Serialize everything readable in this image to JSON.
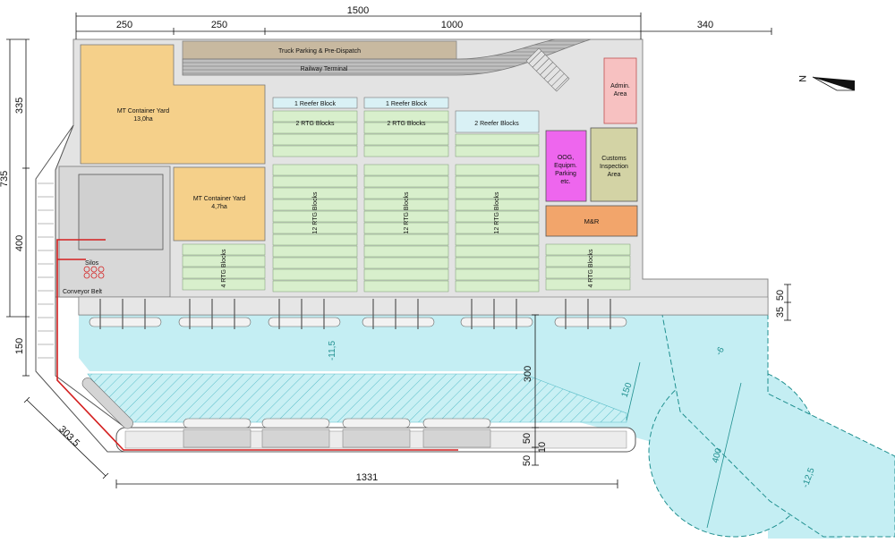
{
  "dimensions": {
    "top_total": "1500",
    "top_left_1": "250",
    "top_left_2": "250",
    "top_mid": "1000",
    "top_right": "340",
    "left_335": "335",
    "left_735": "735",
    "left_400": "400",
    "left_150": "150",
    "right_50": "50",
    "right_35": "35",
    "berth_300": "300",
    "d150": "150",
    "d400": "400",
    "d50a": "50",
    "d10": "10",
    "d50b": "50",
    "bottom_1331": "1331",
    "diag_303": "303.5"
  },
  "labels": {
    "truck_parking": "Truck Parking & Pre-Dispatch",
    "railway": "Railway Terminal",
    "mt_yard_1": "MT Container Yard",
    "mt_yard_1_area": "13,0ha",
    "mt_yard_2": "MT Container Yard",
    "mt_yard_2_area": "4,7ha",
    "reefer_1": "1 Reefer Block",
    "reefer_2": "1 Reefer Block",
    "reefer_3": "2 Reefer Blocks",
    "rtg2_a": "2 RTG Blocks",
    "rtg2_b": "2 RTG Blocks",
    "rtg12_a": "12 RTG Blocks",
    "rtg12_b": "12 RTG Blocks",
    "rtg12_c": "12 RTG Blocks",
    "rtg4_a": "4 RTG Blocks",
    "rtg4_b": "4 RTG Blocks",
    "admin_1": "Admin.",
    "admin_2": "Area",
    "oog_1": "OOG,",
    "oog_2": "Equipm.",
    "oog_3": "Parking",
    "oog_4": "etc.",
    "customs_1": "Customs",
    "customs_2": "Inspection",
    "customs_3": "Area",
    "mr": "M&R",
    "silos": "Silos",
    "conveyor": "Conveyor Belt",
    "depth_115": "-11,5",
    "depth_6": "-6",
    "depth_125": "-12,5",
    "north": "N"
  },
  "colors": {
    "yard_orange": "#f5d08a",
    "rtg_green": "#d8efcc",
    "reefer_blue": "#d9f1f5",
    "admin_pink": "#f7c1c1",
    "oog_magenta": "#ee66ee",
    "customs_olive": "#d3d3a5",
    "mr_orange": "#f2a56b",
    "terminal_grey": "#e3e3e3",
    "water_cyan": "#c4eef3",
    "conveyor_red": "#d42020"
  }
}
